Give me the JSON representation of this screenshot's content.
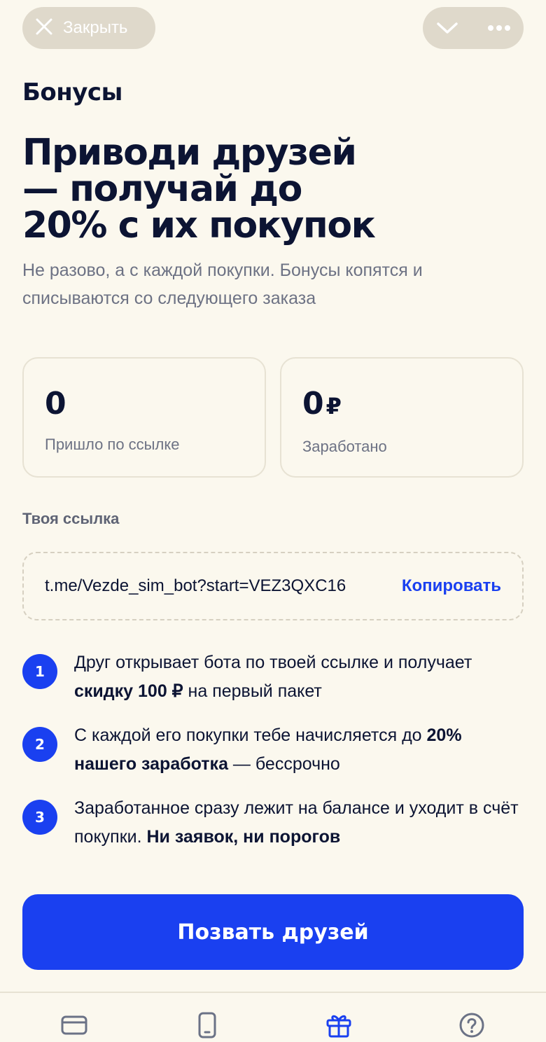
{
  "topbar": {
    "close_label": "Закрыть",
    "icons": [
      "close-icon",
      "chevron-down-icon",
      "more-dots-icon"
    ]
  },
  "section_title": "Бонусы",
  "headline": {
    "line1": "Приводи друзей",
    "line2": "— получай до",
    "line3": "20% с их покупок"
  },
  "subtitle": "Не разово, а с каждой покупки. Бонусы копятся и списываются со следующего заказа",
  "stats": [
    {
      "value": "0",
      "currency": "",
      "caption": "Пришло по ссылке"
    },
    {
      "value": "0",
      "currency": "₽",
      "caption": "Заработано"
    }
  ],
  "link": {
    "label": "Твоя ссылка",
    "url": "t.me/Vezde_sim_bot?start=VEZ3QXC16",
    "copy_label": "Копировать"
  },
  "steps": [
    {
      "num": "1",
      "pre": "Друг открывает бота по твоей ссылке и получает ",
      "bold": "скидку 100 ₽",
      "post": " на первый пакет"
    },
    {
      "num": "2",
      "pre": "С каждой его покупки тебе начисляется до ",
      "bold": "20% нашего заработка",
      "post": " — бессрочно"
    },
    {
      "num": "3",
      "pre": "Заработанное сразу лежит на балансе и уходит в счёт покупки. ",
      "bold": "Ни заявок, ни порогов",
      "post": ""
    }
  ],
  "cta_label": "Позвать друзей",
  "colors": {
    "background": "#fbf8ee",
    "accent": "#1a40f0",
    "text": "#0c1433",
    "muted": "#6d7284",
    "pill": "#dfd9cb"
  },
  "tabbar": {
    "items": [
      "card-icon",
      "phone-icon",
      "gift-icon",
      "help-icon"
    ],
    "active": "gift-icon"
  }
}
